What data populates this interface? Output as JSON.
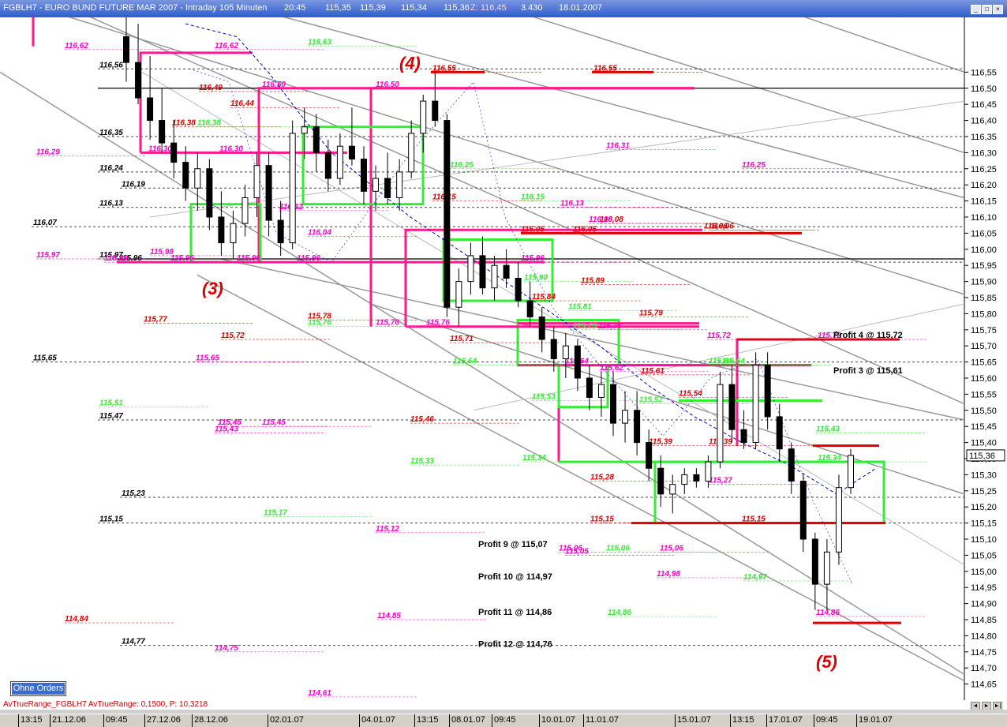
{
  "window": {
    "title": "FGBLH7 - EURO BUND FUTURE MAR 2007 - Intraday 105 Minuten",
    "time": "20:45",
    "o": "115,35",
    "h": "115,39",
    "l": "115,34",
    "c": "115,36",
    "z": "Z: 116,45",
    "volume": "3.430",
    "date": "18.01.2007"
  },
  "orders_button": "Ohne Orders",
  "indicator": {
    "name": "AvTrueRange_FGBLH7",
    "label": "AvTrueRange: 0,1500",
    "p": "P: 10,3218"
  },
  "colors": {
    "background": "#ffffff",
    "candle_down": "#000000",
    "candle_up": "#ffffff",
    "box_magenta": "#ff1a8c",
    "box_green": "#33ee33",
    "level_red": "#dd0000",
    "trend_gray": "#999999",
    "ma_blue": "#0000cc"
  },
  "chart_data": {
    "type": "candlestick",
    "y_range": [
      114.6,
      116.72
    ],
    "y_ticks": [
      "116,55",
      "116,50",
      "116,45",
      "116,40",
      "116,35",
      "116,30",
      "116,25",
      "116,20",
      "116,15",
      "116,10",
      "116,05",
      "116,00",
      "115,95",
      "115,90",
      "115,85",
      "115,80",
      "115,75",
      "115,70",
      "115,65",
      "115,60",
      "115,55",
      "115,50",
      "115,45",
      "115,40",
      "115,35",
      "115,30",
      "115,25",
      "115,20",
      "115,15",
      "115,10",
      "115,05",
      "115,00",
      "114,95",
      "114,90",
      "114,85",
      "114,80",
      "114,75",
      "114,70",
      "114,65"
    ],
    "x_ticks": [
      "13:15",
      "21.12.06",
      "09:45",
      "27.12.06",
      "28.12.06",
      "02.01.07",
      "04.01.07",
      "13:15",
      "08.01.07",
      "09:45",
      "10.01.07",
      "11.01.07",
      "15.01.07",
      "13:15",
      "17.01.07",
      "09:45",
      "19.01.07"
    ],
    "current_price": "115,36",
    "candles": [
      [
        116.66,
        116.72,
        116.52,
        116.58
      ],
      [
        116.58,
        116.7,
        116.45,
        116.47
      ],
      [
        116.47,
        116.6,
        116.34,
        116.4
      ],
      [
        116.4,
        116.5,
        116.3,
        116.33
      ],
      [
        116.33,
        116.4,
        116.22,
        116.27
      ],
      [
        116.27,
        116.32,
        116.15,
        116.19
      ],
      [
        116.19,
        116.3,
        116.12,
        116.25
      ],
      [
        116.25,
        116.28,
        116.06,
        116.1
      ],
      [
        116.1,
        116.18,
        115.98,
        116.02
      ],
      [
        116.02,
        116.12,
        115.97,
        116.08
      ],
      [
        116.08,
        116.2,
        116.04,
        116.16
      ],
      [
        116.16,
        116.3,
        116.1,
        116.26
      ],
      [
        116.26,
        116.3,
        116.04,
        116.09
      ],
      [
        116.09,
        116.15,
        115.98,
        116.02
      ],
      [
        116.02,
        116.4,
        116.0,
        116.36
      ],
      [
        116.36,
        116.44,
        116.28,
        116.38
      ],
      [
        116.38,
        116.42,
        116.24,
        116.3
      ],
      [
        116.3,
        116.34,
        116.18,
        116.22
      ],
      [
        116.22,
        116.36,
        116.2,
        116.32
      ],
      [
        116.32,
        116.44,
        116.26,
        116.28
      ],
      [
        116.28,
        116.32,
        116.14,
        116.18
      ],
      [
        116.18,
        116.26,
        116.12,
        116.22
      ],
      [
        116.22,
        116.3,
        116.14,
        116.16
      ],
      [
        116.16,
        116.28,
        116.12,
        116.24
      ],
      [
        116.24,
        116.4,
        116.22,
        116.36
      ],
      [
        116.36,
        116.48,
        116.3,
        116.46
      ],
      [
        116.46,
        116.55,
        116.38,
        116.4
      ],
      [
        116.4,
        116.42,
        115.79,
        115.82
      ],
      [
        115.82,
        115.94,
        115.76,
        115.9
      ],
      [
        115.9,
        116.02,
        115.86,
        115.98
      ],
      [
        115.98,
        116.04,
        115.86,
        115.88
      ],
      [
        115.88,
        115.98,
        115.84,
        115.95
      ],
      [
        115.95,
        116.0,
        115.88,
        115.91
      ],
      [
        115.91,
        115.96,
        115.82,
        115.84
      ],
      [
        115.84,
        115.9,
        115.76,
        115.79
      ],
      [
        115.79,
        115.82,
        115.68,
        115.72
      ],
      [
        115.72,
        115.76,
        115.62,
        115.66
      ],
      [
        115.66,
        115.74,
        115.6,
        115.7
      ],
      [
        115.7,
        115.72,
        115.56,
        115.6
      ],
      [
        115.6,
        115.64,
        115.5,
        115.54
      ],
      [
        115.54,
        115.62,
        115.48,
        115.58
      ],
      [
        115.58,
        115.62,
        115.42,
        115.46
      ],
      [
        115.46,
        115.56,
        115.4,
        115.5
      ],
      [
        115.5,
        115.56,
        115.36,
        115.4
      ],
      [
        115.4,
        115.44,
        115.28,
        115.32
      ],
      [
        115.32,
        115.36,
        115.2,
        115.24
      ],
      [
        115.24,
        115.3,
        115.18,
        115.27
      ],
      [
        115.27,
        115.32,
        115.24,
        115.3
      ],
      [
        115.3,
        115.32,
        115.26,
        115.28
      ],
      [
        115.28,
        115.36,
        115.26,
        115.34
      ],
      [
        115.34,
        115.62,
        115.32,
        115.58
      ],
      [
        115.58,
        115.64,
        115.4,
        115.44
      ],
      [
        115.44,
        115.5,
        115.38,
        115.4
      ],
      [
        115.4,
        115.68,
        115.38,
        115.64
      ],
      [
        115.64,
        115.68,
        115.44,
        115.48
      ],
      [
        115.48,
        115.52,
        115.34,
        115.38
      ],
      [
        115.38,
        115.4,
        115.24,
        115.28
      ],
      [
        115.28,
        115.3,
        115.06,
        115.1
      ],
      [
        115.1,
        115.12,
        114.88,
        114.96
      ],
      [
        114.96,
        115.1,
        114.88,
        115.06
      ],
      [
        115.06,
        115.3,
        115.02,
        115.26
      ],
      [
        115.26,
        115.38,
        115.24,
        115.36
      ]
    ],
    "level_labels": [
      {
        "t": "116,62",
        "v": 116.62,
        "c": "#ff00cc"
      },
      {
        "t": "116,62",
        "v": 116.62,
        "c": "#ff00cc"
      },
      {
        "t": "116,63",
        "v": 116.63,
        "c": "#33ee33"
      },
      {
        "t": "116,55",
        "v": 116.55,
        "c": "#dd0000"
      },
      {
        "t": "116,55",
        "v": 116.55,
        "c": "#dd0000"
      },
      {
        "t": "116,50",
        "v": 116.5,
        "c": "#ff00cc"
      },
      {
        "t": "116,50",
        "v": 116.5,
        "c": "#ff00cc"
      },
      {
        "t": "116,49",
        "v": 116.49,
        "c": "#dd0000"
      },
      {
        "t": "116,44",
        "v": 116.44,
        "c": "#dd0000"
      },
      {
        "t": "116,38",
        "v": 116.38,
        "c": "#dd0000"
      },
      {
        "t": "116,38",
        "v": 116.38,
        "c": "#33ee33"
      },
      {
        "t": "116,31",
        "v": 116.31,
        "c": "#ff00cc"
      },
      {
        "t": "116,30",
        "v": 116.3,
        "c": "#ff00cc"
      },
      {
        "t": "116,30",
        "v": 116.3,
        "c": "#ff00cc"
      },
      {
        "t": "116,29",
        "v": 116.29,
        "c": "#ff00cc"
      },
      {
        "t": "116,25",
        "v": 116.25,
        "c": "#33ee33"
      },
      {
        "t": "116,25",
        "v": 116.25,
        "c": "#ff00cc"
      },
      {
        "t": "116,15",
        "v": 116.15,
        "c": "#dd0000"
      },
      {
        "t": "116,15",
        "v": 116.15,
        "c": "#33ee33"
      },
      {
        "t": "116,13",
        "v": 116.13,
        "c": "#ff00cc"
      },
      {
        "t": "116,12",
        "v": 116.12,
        "c": "#ff00cc"
      },
      {
        "t": "116,08",
        "v": 116.08,
        "c": "#dd0000"
      },
      {
        "t": "116,08",
        "v": 116.08,
        "c": "#ff00cc"
      },
      {
        "t": "116,06",
        "v": 116.06,
        "c": "#dd0000"
      },
      {
        "t": "116,06",
        "v": 116.06,
        "c": "#dd0000"
      },
      {
        "t": "116,05",
        "v": 116.05,
        "c": "#dd0000"
      },
      {
        "t": "116,05",
        "v": 116.05,
        "c": "#dd0000"
      },
      {
        "t": "116,04",
        "v": 116.04,
        "c": "#ff00cc"
      },
      {
        "t": "115,98",
        "v": 115.98,
        "c": "#ff00cc"
      },
      {
        "t": "115,97",
        "v": 115.97,
        "c": "#ff00cc"
      },
      {
        "t": "115,96",
        "v": 115.96,
        "c": "#ff00cc"
      },
      {
        "t": "115,96",
        "v": 115.96,
        "c": "#ff00cc"
      },
      {
        "t": "115,96",
        "v": 115.96,
        "c": "#ff00cc"
      },
      {
        "t": "115,96",
        "v": 115.96,
        "c": "#ff00cc"
      },
      {
        "t": "115,96",
        "v": 115.96,
        "c": "#ff00cc"
      },
      {
        "t": "115,90",
        "v": 115.9,
        "c": "#33ee33"
      },
      {
        "t": "115,89",
        "v": 115.89,
        "c": "#dd0000"
      },
      {
        "t": "115,84",
        "v": 115.84,
        "c": "#dd0000"
      },
      {
        "t": "115,81",
        "v": 115.81,
        "c": "#33ee33"
      },
      {
        "t": "115,79",
        "v": 115.79,
        "c": "#dd0000"
      },
      {
        "t": "115,78",
        "v": 115.78,
        "c": "#dd0000"
      },
      {
        "t": "115,77",
        "v": 115.77,
        "c": "#dd0000"
      },
      {
        "t": "115,76",
        "v": 115.76,
        "c": "#ff00cc"
      },
      {
        "t": "115,76",
        "v": 115.76,
        "c": "#33ee33"
      },
      {
        "t": "115,76",
        "v": 115.76,
        "c": "#ff00cc"
      },
      {
        "t": "115,75",
        "v": 115.75,
        "c": "#33ee33"
      },
      {
        "t": "115,75",
        "v": 115.75,
        "c": "#ff00cc"
      },
      {
        "t": "115,72",
        "v": 115.72,
        "c": "#ff00cc"
      },
      {
        "t": "115,72",
        "v": 115.72,
        "c": "#ff00cc"
      },
      {
        "t": "115,72",
        "v": 115.72,
        "c": "#dd0000"
      },
      {
        "t": "115,71",
        "v": 115.71,
        "c": "#dd0000"
      },
      {
        "t": "115,65",
        "v": 115.65,
        "c": "#ff00cc"
      },
      {
        "t": "115,64",
        "v": 115.64,
        "c": "#33ee33"
      },
      {
        "t": "115,64",
        "v": 115.64,
        "c": "#ff00cc"
      },
      {
        "t": "115,64",
        "v": 115.64,
        "c": "#33ee33"
      },
      {
        "t": "115,64",
        "v": 115.64,
        "c": "#33ee33"
      },
      {
        "t": "115,62",
        "v": 115.62,
        "c": "#ff00cc"
      },
      {
        "t": "115,61",
        "v": 115.61,
        "c": "#dd0000"
      },
      {
        "t": "115,54",
        "v": 115.54,
        "c": "#dd0000"
      },
      {
        "t": "115,53",
        "v": 115.53,
        "c": "#33ee33"
      },
      {
        "t": "115,52",
        "v": 115.52,
        "c": "#33ee33"
      },
      {
        "t": "115,51",
        "v": 115.51,
        "c": "#33ee33"
      },
      {
        "t": "115,46",
        "v": 115.46,
        "c": "#dd0000"
      },
      {
        "t": "115,45",
        "v": 115.45,
        "c": "#ff00cc"
      },
      {
        "t": "115,45",
        "v": 115.45,
        "c": "#ff00cc"
      },
      {
        "t": "115,45",
        "v": 115.45,
        "c": "#ff00cc"
      },
      {
        "t": "115,43",
        "v": 115.43,
        "c": "#ff00cc"
      },
      {
        "t": "115,43",
        "v": 115.43,
        "c": "#33ee33"
      },
      {
        "t": "115,39",
        "v": 115.39,
        "c": "#dd0000"
      },
      {
        "t": "115,39",
        "v": 115.39,
        "c": "#dd0000"
      },
      {
        "t": "115,34",
        "v": 115.34,
        "c": "#33ee33"
      },
      {
        "t": "115,34",
        "v": 115.34,
        "c": "#33ee33"
      },
      {
        "t": "115,33",
        "v": 115.33,
        "c": "#33ee33"
      },
      {
        "t": "115,28",
        "v": 115.28,
        "c": "#dd0000"
      },
      {
        "t": "115,27",
        "v": 115.27,
        "c": "#ff00cc"
      },
      {
        "t": "115,17",
        "v": 115.17,
        "c": "#33ee33"
      },
      {
        "t": "115,15",
        "v": 115.15,
        "c": "#dd0000"
      },
      {
        "t": "115,15",
        "v": 115.15,
        "c": "#dd0000"
      },
      {
        "t": "115,12",
        "v": 115.12,
        "c": "#ff00cc"
      },
      {
        "t": "115,06",
        "v": 115.06,
        "c": "#ff00cc"
      },
      {
        "t": "115,06",
        "v": 115.06,
        "c": "#33ee33"
      },
      {
        "t": "115,06",
        "v": 115.06,
        "c": "#ff00cc"
      },
      {
        "t": "115,05",
        "v": 115.05,
        "c": "#ff00cc"
      },
      {
        "t": "114,98",
        "v": 114.98,
        "c": "#ff00cc"
      },
      {
        "t": "114,97",
        "v": 114.97,
        "c": "#33ee33"
      },
      {
        "t": "114,86",
        "v": 114.86,
        "c": "#ff00cc"
      },
      {
        "t": "114,86",
        "v": 114.86,
        "c": "#33ee33"
      },
      {
        "t": "114,85",
        "v": 114.85,
        "c": "#ff00cc"
      },
      {
        "t": "114,84",
        "v": 114.84,
        "c": "#dd0000"
      },
      {
        "t": "114,75",
        "v": 114.75,
        "c": "#ff00cc"
      },
      {
        "t": "114,61",
        "v": 114.61,
        "c": "#ff00cc"
      }
    ],
    "black_levels": [
      {
        "t": "116,56",
        "v": 116.56
      },
      {
        "t": "116,35",
        "v": 116.35
      },
      {
        "t": "116,24",
        "v": 116.24
      },
      {
        "t": "116,19",
        "v": 116.19
      },
      {
        "t": "116,13",
        "v": 116.13
      },
      {
        "t": "116,07",
        "v": 116.07
      },
      {
        "t": "115,97",
        "v": 115.97
      },
      {
        "t": "115,96",
        "v": 115.96
      },
      {
        "t": "115,65",
        "v": 115.65
      },
      {
        "t": "115,47",
        "v": 115.47
      },
      {
        "t": "115,23",
        "v": 115.23
      },
      {
        "t": "115,15",
        "v": 115.15
      },
      {
        "t": "114,77",
        "v": 114.77
      }
    ],
    "wave_labels": [
      "(4)",
      "(3)",
      "(5)"
    ],
    "profit_targets": [
      {
        "t": "Profit 4 @ 115,72",
        "v": 115.72
      },
      {
        "t": "Profit 3 @ 115,61",
        "v": 115.61
      },
      {
        "t": "Profit 9 @ 115,07",
        "v": 115.07
      },
      {
        "t": "Profit 10 @ 114,97",
        "v": 114.97
      },
      {
        "t": "Profit 11 @ 114,86",
        "v": 114.86
      },
      {
        "t": "Profit 12 @ 114,76",
        "v": 114.76
      }
    ]
  }
}
